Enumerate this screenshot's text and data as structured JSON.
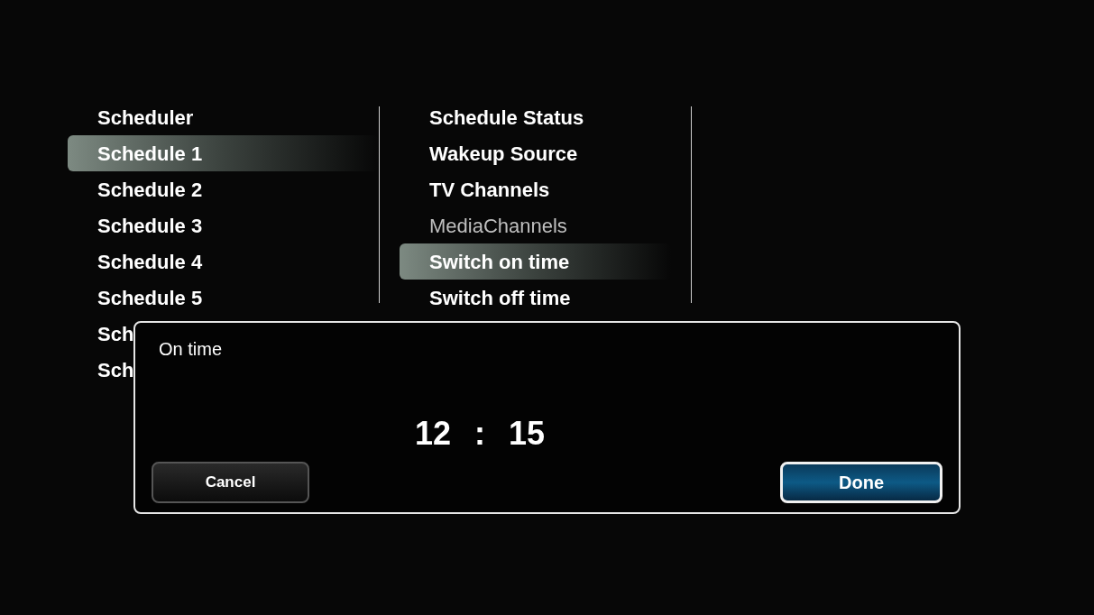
{
  "main_menu": {
    "items": [
      {
        "label": "Scheduler",
        "selected": false
      },
      {
        "label": "Schedule 1",
        "selected": true
      },
      {
        "label": "Schedule 2",
        "selected": false
      },
      {
        "label": "Schedule 3",
        "selected": false
      },
      {
        "label": "Schedule 4",
        "selected": false
      },
      {
        "label": "Schedule 5",
        "selected": false
      },
      {
        "label": "Sch",
        "selected": false
      },
      {
        "label": "Sch",
        "selected": false
      }
    ]
  },
  "sub_menu": {
    "items": [
      {
        "label": "Schedule Status",
        "selected": false,
        "disabled": false
      },
      {
        "label": "Wakeup Source",
        "selected": false,
        "disabled": false
      },
      {
        "label": "TV Channels",
        "selected": false,
        "disabled": false
      },
      {
        "label": "MediaChannels",
        "selected": false,
        "disabled": true
      },
      {
        "label": "Switch on time",
        "selected": true,
        "disabled": false
      },
      {
        "label": "Switch off time",
        "selected": false,
        "disabled": false
      }
    ]
  },
  "dialog": {
    "title": "On time",
    "hours": "12",
    "separator": ":",
    "minutes": "15",
    "buttons": [
      {
        "label": "Cancel",
        "selected": false
      },
      {
        "label": "Done",
        "selected": true
      }
    ]
  }
}
